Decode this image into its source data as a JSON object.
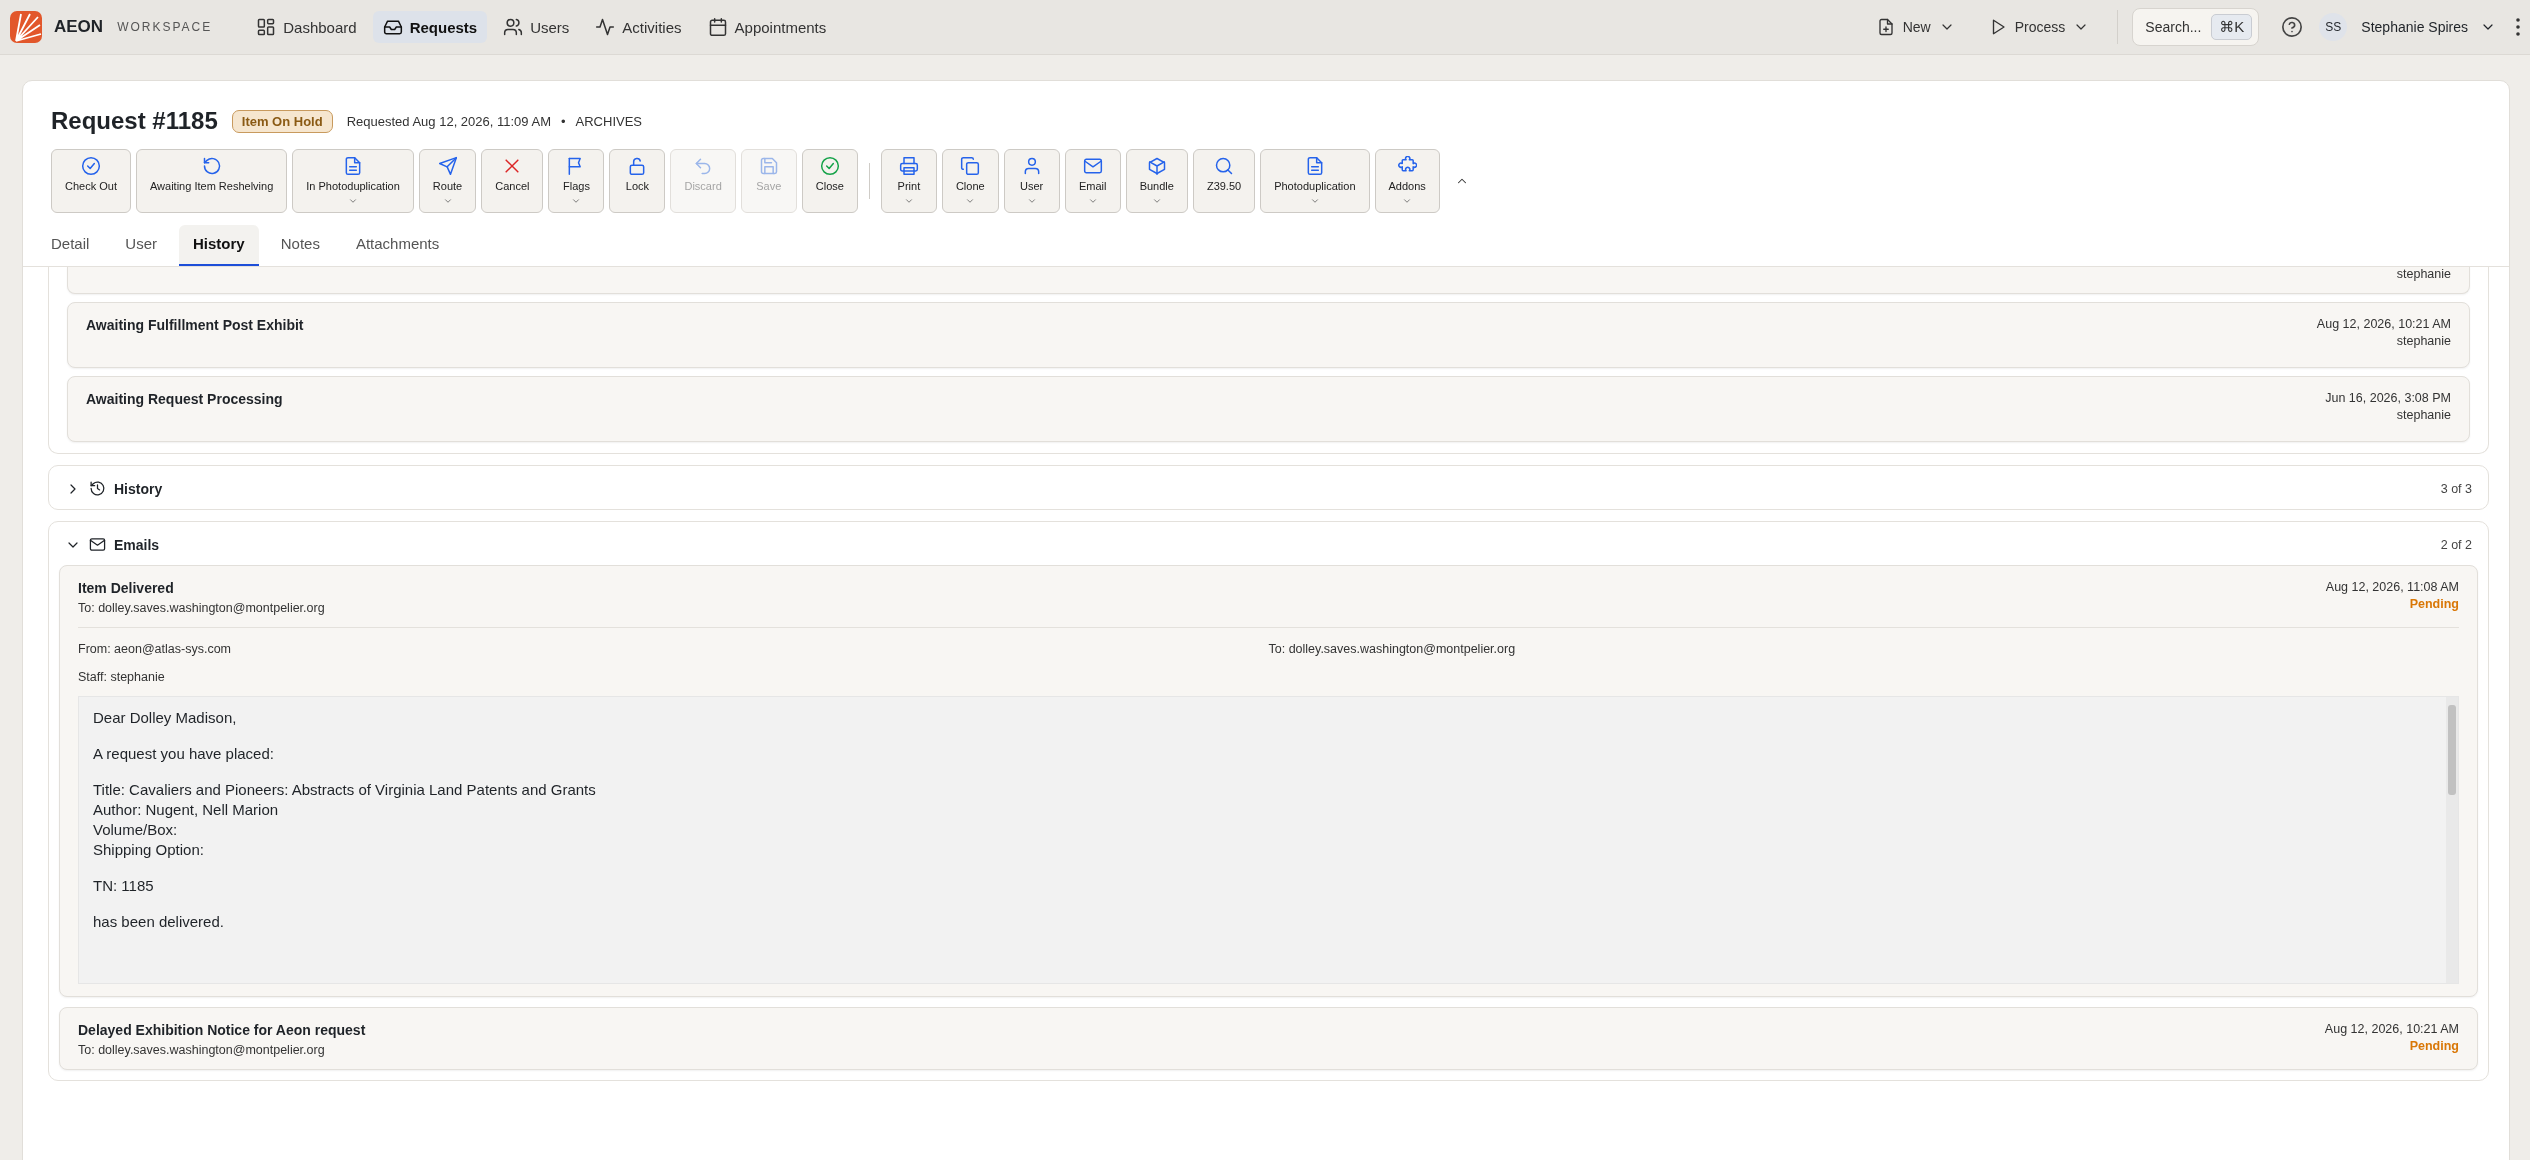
{
  "topbar": {
    "brand": "AEON",
    "product": "WORKSPACE",
    "nav": [
      {
        "label": "Dashboard",
        "selected": false
      },
      {
        "label": "Requests",
        "selected": true
      },
      {
        "label": "Users",
        "selected": false
      },
      {
        "label": "Activities",
        "selected": false
      },
      {
        "label": "Appointments",
        "selected": false
      }
    ],
    "actions": [
      "New",
      "Process"
    ],
    "search": {
      "placeholder": "Search...",
      "shortcut": "⌘K"
    },
    "user": {
      "initials": "SS",
      "name": "Stephanie Spires"
    }
  },
  "request": {
    "title": "Request #1185",
    "status": "Item On Hold",
    "requested": "Requested Aug 12, 2026, 11:09 AM",
    "separator": "•",
    "site": "ARCHIVES"
  },
  "toolbar": [
    {
      "label": "Check Out",
      "dropdown": false,
      "disabled": false
    },
    {
      "label": "Awaiting Item Reshelving",
      "dropdown": false,
      "disabled": false
    },
    {
      "label": "In Photoduplication",
      "dropdown": true,
      "disabled": false
    },
    {
      "label": "Route",
      "dropdown": true,
      "disabled": false
    },
    {
      "label": "Cancel",
      "dropdown": false,
      "disabled": false
    },
    {
      "label": "Flags",
      "dropdown": true,
      "disabled": false
    },
    {
      "label": "Lock",
      "dropdown": false,
      "disabled": false
    },
    {
      "label": "Discard",
      "dropdown": false,
      "disabled": true
    },
    {
      "label": "Save",
      "dropdown": false,
      "disabled": true
    },
    {
      "label": "Close",
      "dropdown": false,
      "disabled": false
    },
    {
      "label": "Print",
      "dropdown": true,
      "disabled": false
    },
    {
      "label": "Clone",
      "dropdown": true,
      "disabled": false
    },
    {
      "label": "User",
      "dropdown": true,
      "disabled": false
    },
    {
      "label": "Email",
      "dropdown": true,
      "disabled": false
    },
    {
      "label": "Bundle",
      "dropdown": true,
      "disabled": false
    },
    {
      "label": "Z39.50",
      "dropdown": false,
      "disabled": false
    },
    {
      "label": "Photoduplication",
      "dropdown": true,
      "disabled": false
    },
    {
      "label": "Addons",
      "dropdown": true,
      "disabled": false
    }
  ],
  "tabs": [
    {
      "label": "Detail",
      "selected": false
    },
    {
      "label": "User",
      "selected": false
    },
    {
      "label": "History",
      "selected": true
    },
    {
      "label": "Notes",
      "selected": false
    },
    {
      "label": "Attachments",
      "selected": false
    }
  ],
  "status_history": [
    {
      "user": "stephanie"
    },
    {
      "title": "Awaiting Fulfillment Post Exhibit",
      "date": "Aug 12, 2026, 10:21 AM",
      "user": "stephanie"
    },
    {
      "title": "Awaiting Request Processing",
      "date": "Jun 16, 2026, 3:08 PM",
      "user": "stephanie"
    }
  ],
  "sections": [
    {
      "title": "History",
      "count": "3 of 3",
      "expanded": false
    },
    {
      "title": "Emails",
      "count": "2 of 2",
      "expanded": true
    }
  ],
  "emails": [
    {
      "subject": "Item Delivered",
      "to": "To: dolley.saves.washington@montpelier.org",
      "date": "Aug 12, 2026, 11:08 AM",
      "status": "Pending",
      "expanded": true,
      "from": "From: aeon@atlas-sys.com",
      "to_detail": "To: dolley.saves.washington@montpelier.org",
      "staff": "Staff: stephanie",
      "body": [
        [
          "Dear Dolley Madison,"
        ],
        [
          "A request you have placed:"
        ],
        [
          "Title: Cavaliers and Pioneers: Abstracts of Virginia Land Patents and Grants",
          "Author: Nugent, Nell Marion",
          "Volume/Box:",
          "Shipping Option:"
        ],
        [
          "TN: 1185"
        ],
        [
          "has been delivered."
        ]
      ]
    },
    {
      "subject": "Delayed Exhibition Notice for Aeon request",
      "to": "To: dolley.saves.washington@montpelier.org",
      "date": "Aug 12, 2026, 10:21 AM",
      "status": "Pending",
      "expanded": false
    }
  ]
}
